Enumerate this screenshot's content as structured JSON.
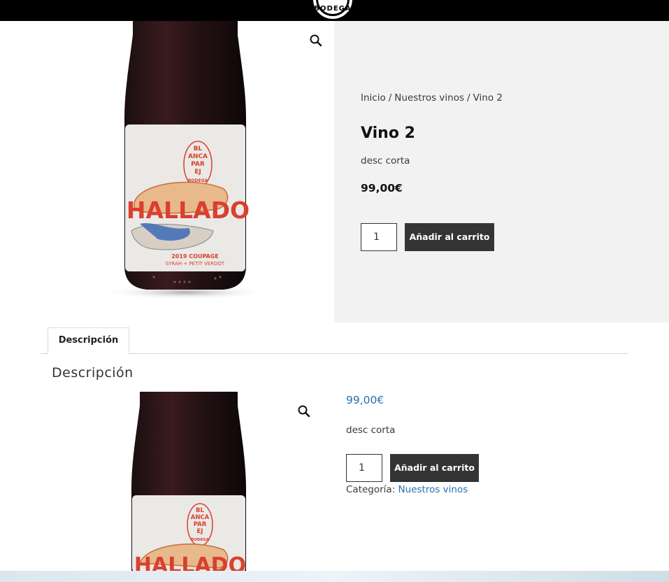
{
  "header": {
    "logo_text": "BODEGA"
  },
  "breadcrumb": {
    "home": "Inicio",
    "category": "Nuestros vinos",
    "current": "Vino 2",
    "separator": "/"
  },
  "product": {
    "title": "Vino 2",
    "short_description": "desc corta",
    "price": "99,00€",
    "quantity": "1",
    "add_to_cart": "Añadir al carrito",
    "category_label": "Categoría:",
    "category_value": "Nuestros vinos"
  },
  "label_art": {
    "brand_lines": [
      "BL",
      "ANCA",
      "PAR",
      "EJ",
      "BODEGA"
    ],
    "name": "HALLADO",
    "vintage": "2019 COUPAGE",
    "grapes": "SYRAH + PETIT VERDOT"
  },
  "tabs": [
    {
      "label": "Descripción"
    }
  ],
  "description_heading": "Descripción",
  "icons": {
    "zoom": "magnifier-icon"
  },
  "colors": {
    "topbar": "#000000",
    "button": "#343434",
    "link": "#2a6fb0",
    "panel": "#f2f2f2"
  }
}
